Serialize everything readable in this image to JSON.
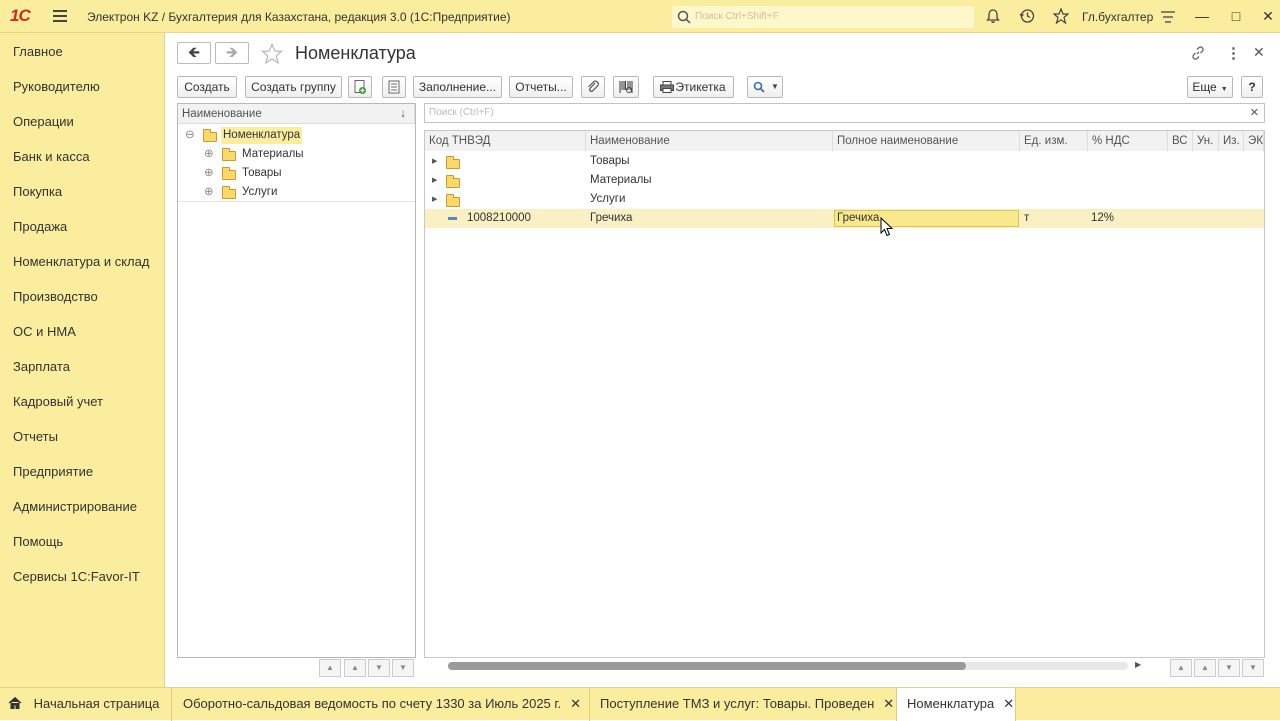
{
  "app": {
    "logo": "1С",
    "title": "Электрон KZ / Бухгалтерия для Казахстана, редакция 3.0  (1С:Предприятие)",
    "search_placeholder": "Поиск Ctrl+Shift+F",
    "user": "Гл.бухгалтер"
  },
  "sidebar": {
    "items": [
      "Главное",
      "Руководителю",
      "Операции",
      "Банк и касса",
      "Покупка",
      "Продажа",
      "Номенклатура и склад",
      "Производство",
      "ОС и НМА",
      "Зарплата",
      "Кадровый учет",
      "Отчеты",
      "Предприятие",
      "Администрирование",
      "Помощь",
      "Сервисы 1С:Favor-IT"
    ]
  },
  "page": {
    "title": "Номенклатура"
  },
  "toolbar": {
    "create": "Создать",
    "create_group": "Создать группу",
    "fill": "Заполнение...",
    "reports": "Отчеты...",
    "label": "Этикетка",
    "more": "Еще",
    "help": "?"
  },
  "tree": {
    "header": "Наименование",
    "sort_icon": "↓",
    "root": "Номенклатура",
    "children": [
      "Материалы",
      "Товары",
      "Услуги"
    ]
  },
  "list": {
    "search_placeholder": "Поиск (Ctrl+F)",
    "columns": [
      "Код ТНВЭД",
      "Наименование",
      "Полное наименование",
      "Ед. изм.",
      "% НДС",
      "ВС",
      "Ун.",
      "Из.",
      "ЭК"
    ],
    "groups": [
      "Товары",
      "Материалы",
      "Услуги"
    ],
    "item": {
      "code": "1008210000",
      "name": "Гречиха",
      "full_name": "Гречиха",
      "unit": "т",
      "vat": "12%"
    }
  },
  "taskbar": {
    "home": "Начальная страница",
    "tabs": [
      "Оборотно-сальдовая ведомость по счету 1330  за Июль 2025 г.",
      "Поступление ТМЗ и услуг: Товары. Проведен",
      "Номенклатура"
    ]
  },
  "colors": {
    "accent": "#fbed9e",
    "selected_row": "#fbf0c4",
    "cell_active": "#f8e88e"
  }
}
